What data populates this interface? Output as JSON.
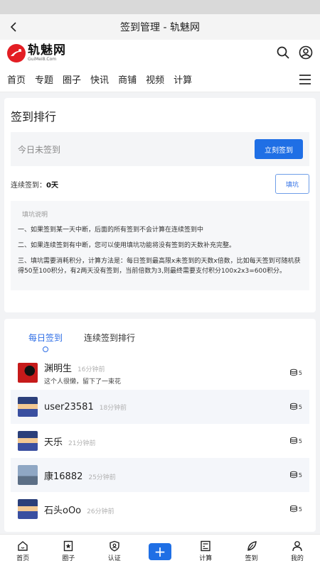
{
  "title_bar": {
    "title": "签到管理 - 轨魅网"
  },
  "logo": {
    "cn": "轨魅网",
    "en": "GuiMei8.Com"
  },
  "nav": {
    "items": [
      "首页",
      "专题",
      "圈子",
      "快讯",
      "商铺",
      "视频",
      "计算"
    ]
  },
  "signin": {
    "title": "签到排行",
    "today_status": "今日未签到",
    "signin_button": "立刻签到",
    "streak_label": "连续签到：",
    "streak_value": "0天",
    "fill_button": "填坑",
    "explain_title": "填坑说明",
    "explain_items": [
      "一、如果签到某一天中断，后面的所有签到不会计算在连续签到中",
      "二、如果连续签到有中断，您可以使用填坑功能将没有签到的天数补充完整。",
      "三、填坑需要消耗积分，计算方法是：每日签到最高限x未签到的天数x倍数，比如每天签到可随机获得50至100积分，有2两天没有签到，当前倍数为3,则最终需要支付积分100x2x3=600积分。"
    ]
  },
  "list": {
    "tabs": [
      "每日签到",
      "连续签到排行"
    ],
    "users": [
      {
        "name": "渊明生",
        "time": "16分钟前",
        "signature": "这个人很懒，留下了一束花",
        "points": "5"
      },
      {
        "name": "user23581",
        "time": "18分钟前",
        "signature": "",
        "points": "5"
      },
      {
        "name": "天乐",
        "time": "21分钟前",
        "signature": "",
        "points": "5"
      },
      {
        "name": "康16882",
        "time": "25分钟前",
        "signature": "",
        "points": "5"
      },
      {
        "name": "石头oOo",
        "time": "26分钟前",
        "signature": "",
        "points": "5"
      }
    ]
  },
  "bottom_nav": {
    "home": "首页",
    "circle": "圈子",
    "verify": "认证",
    "add": "+",
    "calc": "计算",
    "signin": "签到",
    "me": "我的"
  },
  "colors": {
    "accent": "#1f6fe5",
    "brand_red": "#e31e24"
  }
}
